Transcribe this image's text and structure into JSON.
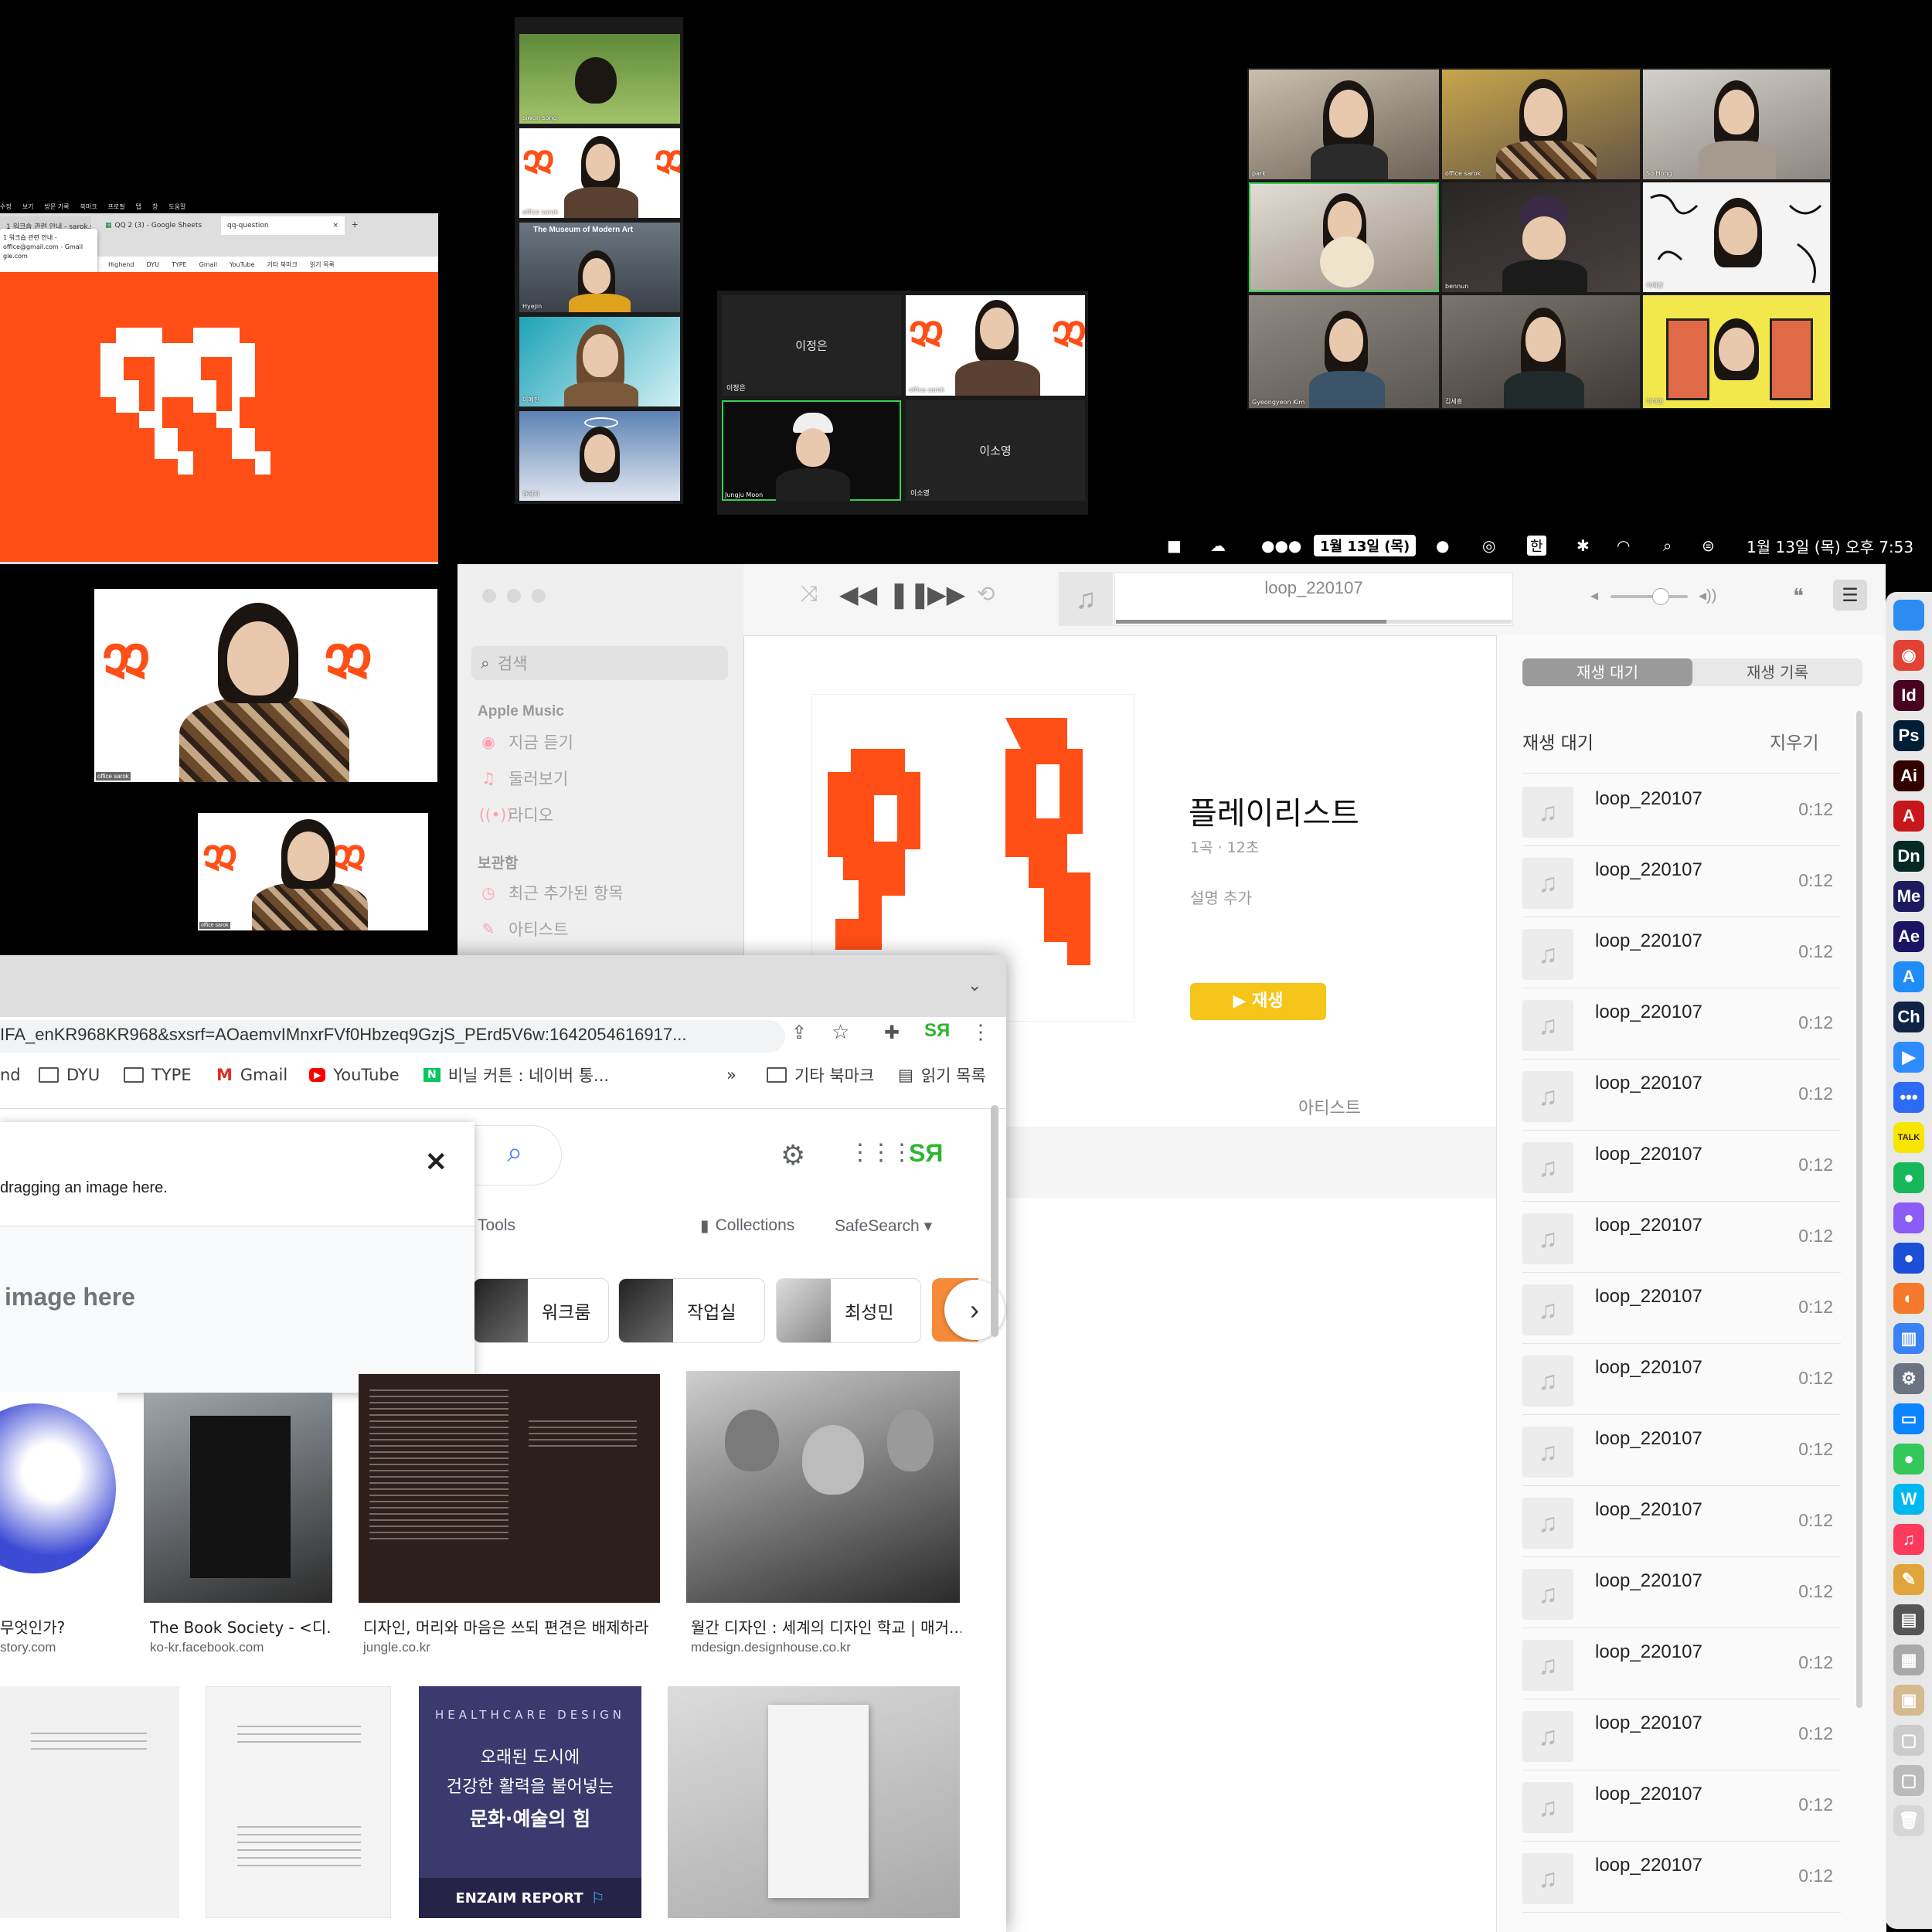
{
  "colors": {
    "accent_orange": "#ff4e16",
    "play_yellow": "#f5c51a",
    "zoom_green": "#33d154",
    "dock_bg": "#e8e8e8"
  },
  "menubar": {
    "date_badge": "1월 13일 (목)",
    "ime": "한",
    "clock": "1월 13일 (목) 오후 7:53"
  },
  "browser_small": {
    "menu": [
      "수정",
      "보기",
      "방문 기록",
      "북마크",
      "프로필",
      "탭",
      "창",
      "도움말"
    ],
    "tabs": [
      "1 워크숍 관련 안내 - sarok.s",
      "QQ 2 (3) - Google Sheets",
      "qq-question"
    ],
    "notification": [
      "1 워크숍 관련 안내 -",
      "office@gmail.com - Gmail",
      "gle.com"
    ],
    "bookmarks": [
      "Highend",
      "DYU",
      "TYPE",
      "Gmail",
      "YouTube",
      "기타 북마크",
      "읽기 목록"
    ]
  },
  "zoom_left": {
    "names": [
      "siwon song",
      "office sarok",
      "Hyejin",
      "이예진",
      "한혜지"
    ],
    "moma_sign": "The Museum of Modern Art"
  },
  "zoom_mid": {
    "tiles": [
      {
        "center": "이정은",
        "name": "이정은"
      },
      {
        "center": "",
        "name": "office sarok"
      },
      {
        "center": "",
        "name": "Jungju Moon"
      },
      {
        "center": "이소영",
        "name": "이소영"
      }
    ]
  },
  "zoom_grid": {
    "names": [
      "park",
      "office sarok",
      "So Hong",
      "",
      "bennun",
      "이예진",
      "Gyeongyeon Kim",
      "김세흥",
      "이하민"
    ]
  },
  "zoom_self": {
    "name1": "office sarok",
    "name2": "office sarok"
  },
  "music": {
    "now_playing": "loop_220107",
    "search_placeholder": "검색",
    "section_apple": "Apple Music",
    "apple_items": [
      {
        "label": "지금 듣기",
        "icon": "play-circle-icon"
      },
      {
        "label": "둘러보기",
        "icon": "music-note-icon"
      },
      {
        "label": "라디오",
        "icon": "radio-icon"
      }
    ],
    "section_library": "보관함",
    "library_items": [
      {
        "label": "최근 추가된 항목",
        "icon": "clock-icon"
      },
      {
        "label": "아티스트",
        "icon": "microphone-icon"
      }
    ],
    "playlist_title": "플레이리스트",
    "playlist_meta": "1곡 · 12초",
    "add_description": "설명 추가",
    "play_button": "▶ 재생",
    "artist_header": "아티스트",
    "queue_tabs": [
      "재생 대기",
      "재생 기록"
    ],
    "queue_header": "재생 대기",
    "clear": "지우기",
    "queue": [
      {
        "title": "loop_220107",
        "duration": "0:12"
      },
      {
        "title": "loop_220107",
        "duration": "0:12"
      },
      {
        "title": "loop_220107",
        "duration": "0:12"
      },
      {
        "title": "loop_220107",
        "duration": "0:12"
      },
      {
        "title": "loop_220107",
        "duration": "0:12"
      },
      {
        "title": "loop_220107",
        "duration": "0:12"
      },
      {
        "title": "loop_220107",
        "duration": "0:12"
      },
      {
        "title": "loop_220107",
        "duration": "0:12"
      },
      {
        "title": "loop_220107",
        "duration": "0:12"
      },
      {
        "title": "loop_220107",
        "duration": "0:12"
      },
      {
        "title": "loop_220107",
        "duration": "0:12"
      },
      {
        "title": "loop_220107",
        "duration": "0:12"
      },
      {
        "title": "loop_220107",
        "duration": "0:12"
      },
      {
        "title": "loop_220107",
        "duration": "0:12"
      },
      {
        "title": "loop_220107",
        "duration": "0:12"
      },
      {
        "title": "loop_220107",
        "duration": "0:12"
      }
    ]
  },
  "chrome": {
    "url": "IFA_enKR968KR968&sxsrf=AOaemvIMnxrFVf0Hbzeq9GzjS_PErd5V6w:1642054616917...",
    "bookmarks": [
      "nd",
      "DYU",
      "TYPE",
      "Gmail",
      "YouTube",
      "비닐 커튼 : 네이버 통...",
      "»",
      "기타 북마크",
      "읽기 목록"
    ],
    "dialog_text": "dragging an image here.",
    "dialog_drop": "image here",
    "tools": "Tools",
    "collections": "Collections",
    "safesearch": "SafeSearch ▾",
    "chips": [
      "워크룸",
      "작업실",
      "최성민"
    ],
    "results_row1": [
      {
        "title": "무엇인가?",
        "source": "story.com"
      },
      {
        "title": "The Book Society - <디...",
        "source": "ko-kr.facebook.com"
      },
      {
        "title": "디자인, 머리와 마음은 쓰되 편견은 배제하라",
        "source": "jungle.co.kr"
      },
      {
        "title": "월간 디자인 : 세계의 디자인 학교 | 매거...",
        "source": "mdesign.designhouse.co.kr"
      }
    ],
    "healthcare": {
      "kicker": "HEALTHCARE DESIGN",
      "line1": "오래된 도시에",
      "line2": "건강한 활력을 불어넣는",
      "line3": "문화·예술의 힘",
      "brand": "ENZAIM REPORT"
    }
  },
  "dock": [
    {
      "icon": "finder-icon",
      "label": "",
      "color": "#2d8cf0"
    },
    {
      "icon": "chrome-icon",
      "label": "◉",
      "color": "#e34133"
    },
    {
      "icon": "indesign-icon",
      "label": "Id",
      "color": "#49021f"
    },
    {
      "icon": "photoshop-icon",
      "label": "Ps",
      "color": "#001e36"
    },
    {
      "icon": "illustrator-icon",
      "label": "Ai",
      "color": "#330000"
    },
    {
      "icon": "acrobat-icon",
      "label": "A",
      "color": "#c8161d"
    },
    {
      "icon": "dimension-icon",
      "label": "Dn",
      "color": "#052924"
    },
    {
      "icon": "media-encoder-icon",
      "label": "Me",
      "color": "#1e1a60"
    },
    {
      "icon": "after-effects-icon",
      "label": "Ae",
      "color": "#1b1464"
    },
    {
      "icon": "app-store-icon",
      "label": "A",
      "color": "#1f8cf7"
    },
    {
      "icon": "character-animator-icon",
      "label": "Ch",
      "color": "#0f2346"
    },
    {
      "icon": "zoom-icon",
      "label": "▶",
      "color": "#2d8cff"
    },
    {
      "icon": "messenger-icon",
      "label": "•••",
      "color": "#2e6bf5"
    },
    {
      "icon": "kakaotalk-icon",
      "label": "TALK",
      "color": "#f7e600"
    },
    {
      "icon": "line-icon",
      "label": "●",
      "color": "#17b85a"
    },
    {
      "icon": "figma-icon",
      "label": "●",
      "color": "#8b5cf6"
    },
    {
      "icon": "cinema4d-icon",
      "label": "●",
      "color": "#1d4ed8"
    },
    {
      "icon": "blender-icon",
      "label": "◐",
      "color": "#f5792a"
    },
    {
      "icon": "notebook-icon",
      "label": "▥",
      "color": "#3b82f6"
    },
    {
      "icon": "system-preferences-icon",
      "label": "⚙",
      "color": "#6b7280"
    },
    {
      "icon": "keynote-icon",
      "label": "▭",
      "color": "#0a84ff"
    },
    {
      "icon": "messages-icon",
      "label": "●",
      "color": "#34c759"
    },
    {
      "icon": "whale-icon",
      "label": "W",
      "color": "#00b8f0"
    },
    {
      "icon": "music-icon",
      "label": "♫",
      "color": "#fb3a5c"
    },
    {
      "icon": "script-editor-icon",
      "label": "✎",
      "color": "#e0a43a"
    },
    {
      "icon": "disk-icon",
      "label": "▤",
      "color": "#555"
    },
    {
      "icon": "preview-icon",
      "label": "▦",
      "color": "#a9a9a9"
    },
    {
      "icon": "photo-icon",
      "label": "▣",
      "color": "#d6b98e"
    },
    {
      "icon": "window-icon",
      "label": "▢",
      "color": "#cccccc"
    },
    {
      "icon": "window-2-icon",
      "label": "▢",
      "color": "#bbbbbb"
    },
    {
      "icon": "trash-icon",
      "label": "🗑",
      "color": "#d6d6d6"
    }
  ]
}
